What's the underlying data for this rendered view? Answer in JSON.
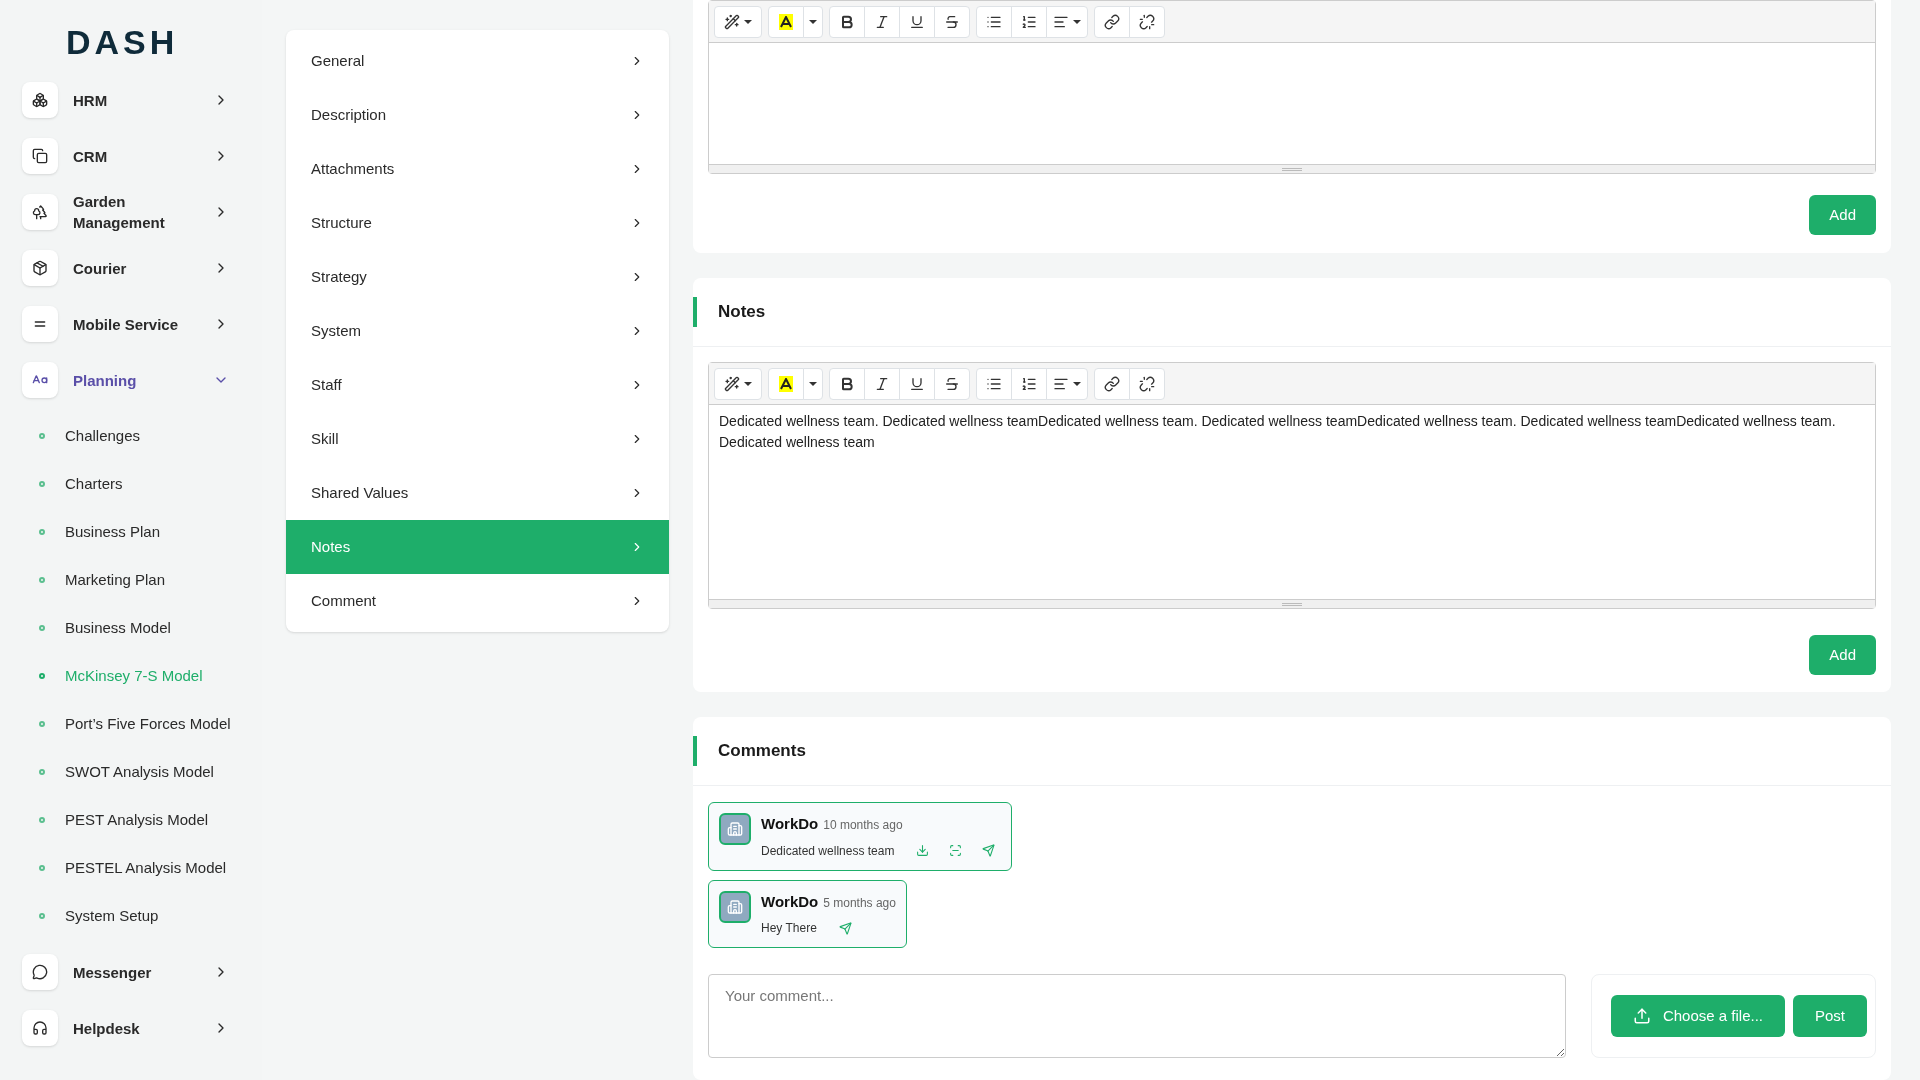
{
  "logo": "DASH",
  "sidebar": {
    "items": [
      {
        "label": "HRM",
        "expanded": false
      },
      {
        "label": "CRM",
        "expanded": false
      },
      {
        "label": "Garden Management",
        "expanded": false
      },
      {
        "label": "Courier",
        "expanded": false
      },
      {
        "label": "Mobile Service",
        "expanded": false
      },
      {
        "label": "Planning",
        "expanded": true,
        "children": [
          {
            "label": "Challenges",
            "selected": false
          },
          {
            "label": "Charters",
            "selected": false
          },
          {
            "label": "Business Plan",
            "selected": false
          },
          {
            "label": "Marketing Plan",
            "selected": false
          },
          {
            "label": "Business Model",
            "selected": false
          },
          {
            "label": "McKinsey 7-S Model",
            "selected": true
          },
          {
            "label": "Port’s Five Forces Model",
            "selected": false
          },
          {
            "label": "SWOT Analysis Model",
            "selected": false
          },
          {
            "label": "PEST Analysis Model",
            "selected": false
          },
          {
            "label": "PESTEL Analysis Model",
            "selected": false
          },
          {
            "label": "System Setup",
            "selected": false
          }
        ]
      },
      {
        "label": "Messenger",
        "expanded": false
      },
      {
        "label": "Helpdesk",
        "expanded": false
      }
    ]
  },
  "section_menu": [
    {
      "label": "General",
      "selected": false
    },
    {
      "label": "Description",
      "selected": false
    },
    {
      "label": "Attachments",
      "selected": false
    },
    {
      "label": "Structure",
      "selected": false
    },
    {
      "label": "Strategy",
      "selected": false
    },
    {
      "label": "System",
      "selected": false
    },
    {
      "label": "Staff",
      "selected": false
    },
    {
      "label": "Skill",
      "selected": false
    },
    {
      "label": "Shared Values",
      "selected": false
    },
    {
      "label": "Notes",
      "selected": true
    },
    {
      "label": "Comment",
      "selected": false
    }
  ],
  "top_editor": {
    "button": "Add"
  },
  "notes": {
    "title": "Notes",
    "content": "Dedicated wellness team. Dedicated wellness teamDedicated wellness team. Dedicated wellness teamDedicated wellness team. Dedicated wellness teamDedicated wellness team. Dedicated wellness team",
    "button": "Add"
  },
  "comments": {
    "title": "Comments",
    "items": [
      {
        "author": "WorkDo",
        "time": "10 months ago",
        "text": "Dedicated wellness team",
        "actions": [
          {
            "kind": "download"
          },
          {
            "kind": "scan"
          },
          {
            "kind": "send"
          }
        ]
      },
      {
        "author": "WorkDo",
        "time": "5 months ago",
        "text": "Hey There",
        "actions": [
          {
            "kind": "send"
          }
        ]
      }
    ],
    "placeholder": "Your comment...",
    "file_button": "Choose a file...",
    "post_button": "Post"
  }
}
